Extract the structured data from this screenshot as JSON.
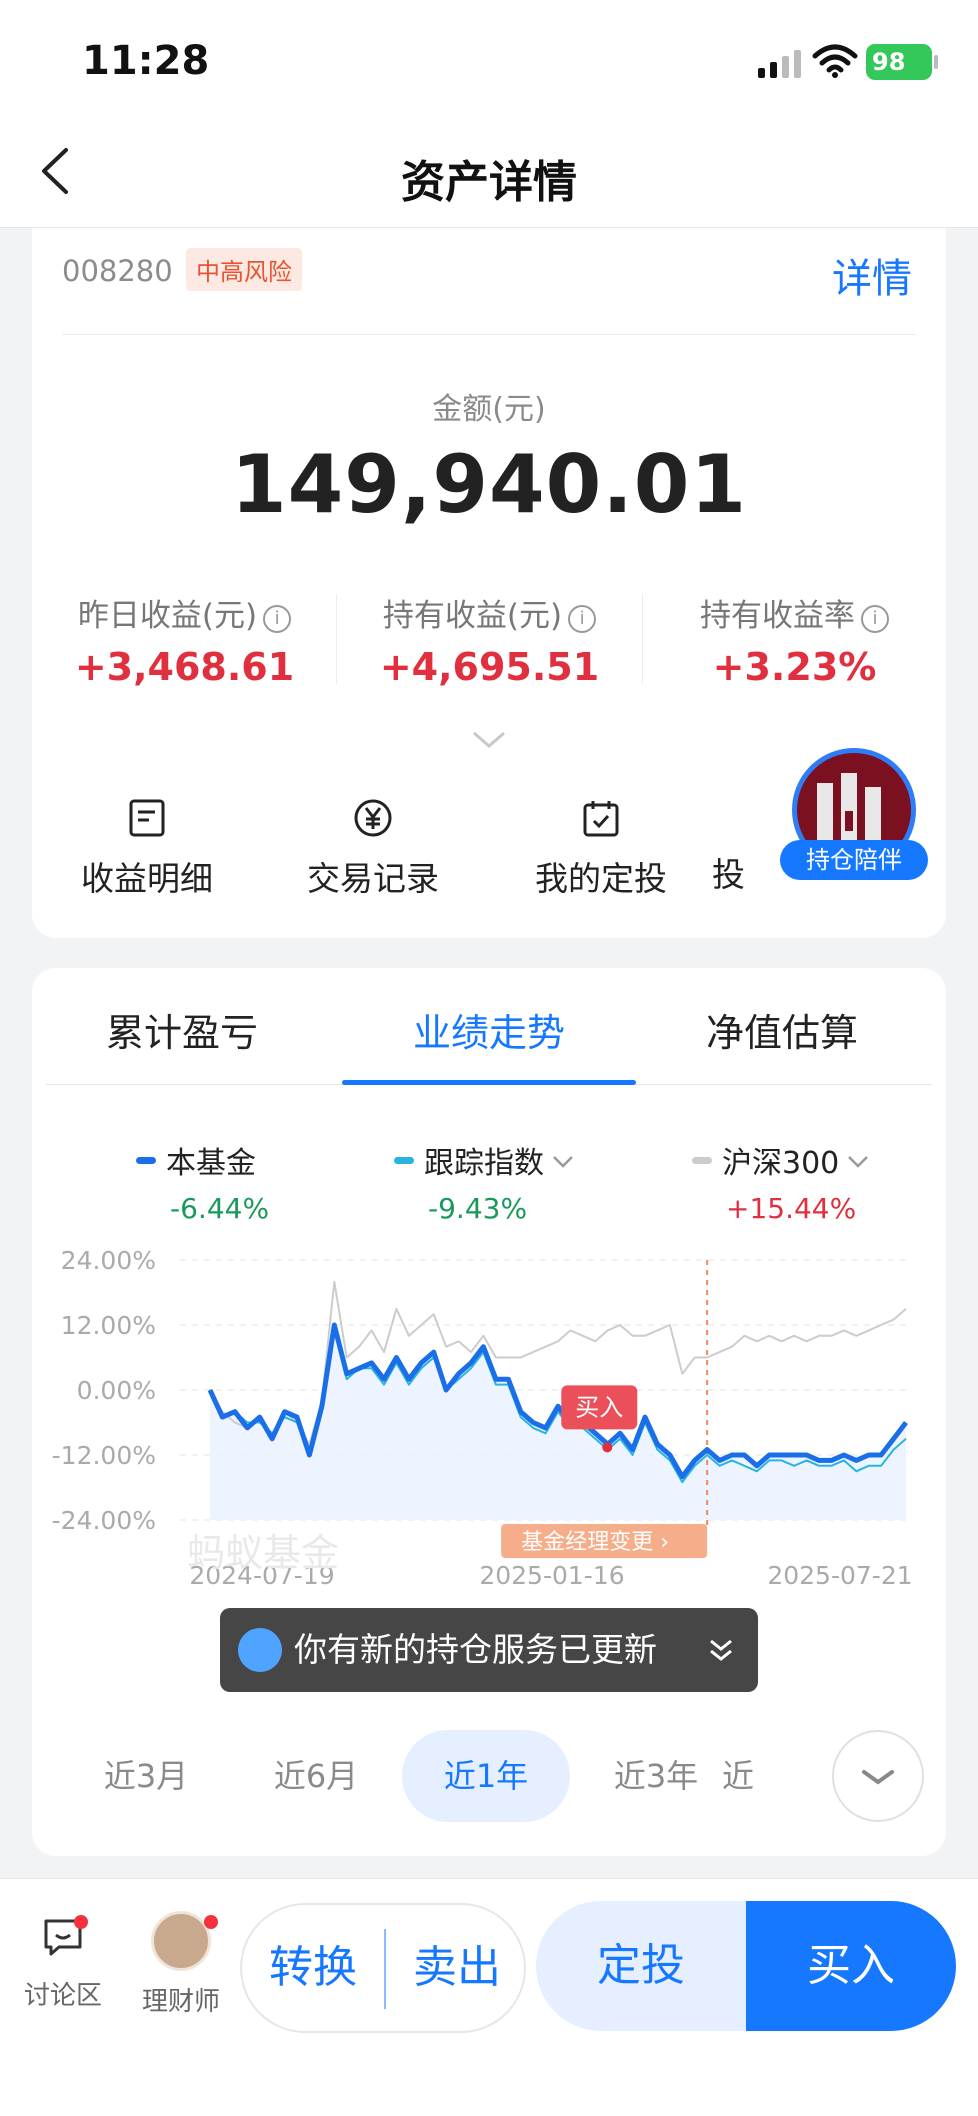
{
  "status_bar": {
    "time": "11:28",
    "battery": "98"
  },
  "nav": {
    "title": "资产详情"
  },
  "fund": {
    "code": "008280",
    "risk": "中高风险",
    "detail_link": "详情",
    "amount_label": "金额(元)",
    "amount": "149,940.01",
    "stats": [
      {
        "label": "昨日收益(元)",
        "value": "+3,468.61"
      },
      {
        "label": "持有收益(元)",
        "value": "+4,695.51"
      },
      {
        "label": "持有收益率",
        "value": "+3.23%"
      }
    ],
    "actions": [
      {
        "label": "收益明细",
        "icon": "document-icon"
      },
      {
        "label": "交易记录",
        "icon": "yuan-icon"
      },
      {
        "label": "我的定投",
        "icon": "calendar-icon"
      },
      {
        "label": "投",
        "icon": ""
      }
    ],
    "companion_label": "持仓陪伴"
  },
  "tabs": [
    {
      "label": "累计盈亏",
      "active": false
    },
    {
      "label": "业绩走势",
      "active": true
    },
    {
      "label": "净值估算",
      "active": false
    }
  ],
  "legend": [
    {
      "name": "本基金",
      "value": "-6.44%",
      "color": "#1a6fe8",
      "value_color": "#1a9a5a"
    },
    {
      "name": "跟踪指数",
      "value": "-9.43%",
      "color": "#27b5e0",
      "value_color": "#1a9a5a"
    },
    {
      "name": "沪深300",
      "value": "+15.44%",
      "color": "#cccccc",
      "value_color": "#e0303f"
    }
  ],
  "chart_data": {
    "type": "line",
    "yticks": [
      "24.00%",
      "12.00%",
      "0.00%",
      "-12.00%",
      "-24.00%"
    ],
    "ylim": [
      -24,
      24
    ],
    "xticks": [
      "2024-07-19",
      "2025-01-16",
      "2025-07-21"
    ],
    "watermark": "蚂蚁基金",
    "annotations": {
      "buy": "买入",
      "manager_change": "基金经理变更"
    },
    "series": [
      {
        "name": "本基金",
        "values": [
          0,
          -5,
          -4,
          -7,
          -5,
          -9,
          -4,
          -5,
          -12,
          -3,
          12,
          3,
          4,
          5,
          2,
          6,
          2,
          5,
          7,
          0,
          3,
          5,
          8,
          2,
          2,
          -4,
          -6,
          -7,
          -3,
          -6,
          -6,
          -8,
          -10,
          -8,
          -11,
          -5,
          -10,
          -12,
          -16,
          -13,
          -11,
          -13,
          -12,
          -12,
          -14,
          -12,
          -12,
          -12,
          -12,
          -13,
          -13,
          -12,
          -13,
          -12,
          -12,
          -9,
          -6
        ]
      },
      {
        "name": "跟踪指数",
        "values": [
          0,
          -5,
          -4,
          -6,
          -6,
          -8,
          -5,
          -6,
          -12,
          -3,
          11,
          2,
          4,
          4,
          1,
          5,
          1,
          4,
          6,
          0,
          2,
          4,
          7,
          1,
          1,
          -5,
          -7,
          -8,
          -4,
          -7,
          -7,
          -9,
          -11,
          -9,
          -12,
          -6,
          -11,
          -13,
          -17,
          -14,
          -12,
          -14,
          -13,
          -14,
          -15,
          -13,
          -13,
          -14,
          -13,
          -14,
          -14,
          -13,
          -15,
          -14,
          -14,
          -11,
          -9
        ]
      },
      {
        "name": "沪深300",
        "values": [
          0,
          -4,
          -6,
          -7,
          -5,
          -9,
          -4,
          -6,
          -10,
          -2,
          20,
          6,
          8,
          11,
          7,
          15,
          10,
          12,
          14,
          8,
          9,
          7,
          10,
          6,
          6,
          6,
          7,
          8,
          9,
          11,
          10,
          9,
          11,
          12,
          10,
          10,
          11,
          12,
          3,
          6,
          6,
          7,
          8,
          10,
          9,
          10,
          9,
          10,
          9,
          10,
          10,
          11,
          10,
          11,
          12,
          13,
          15
        ]
      }
    ]
  },
  "ranges": [
    {
      "label": "近3月",
      "active": false
    },
    {
      "label": "近6月",
      "active": false
    },
    {
      "label": "近1年",
      "active": true
    },
    {
      "label": "近3年",
      "active": false
    },
    {
      "label": "近",
      "active": false
    }
  ],
  "toast": {
    "text": "你有新的持仓服务已更新"
  },
  "bottom": {
    "discuss": "讨论区",
    "advisor": "理财师",
    "switch": "转换",
    "sell": "卖出",
    "auto_invest": "定投",
    "buy": "买入"
  }
}
